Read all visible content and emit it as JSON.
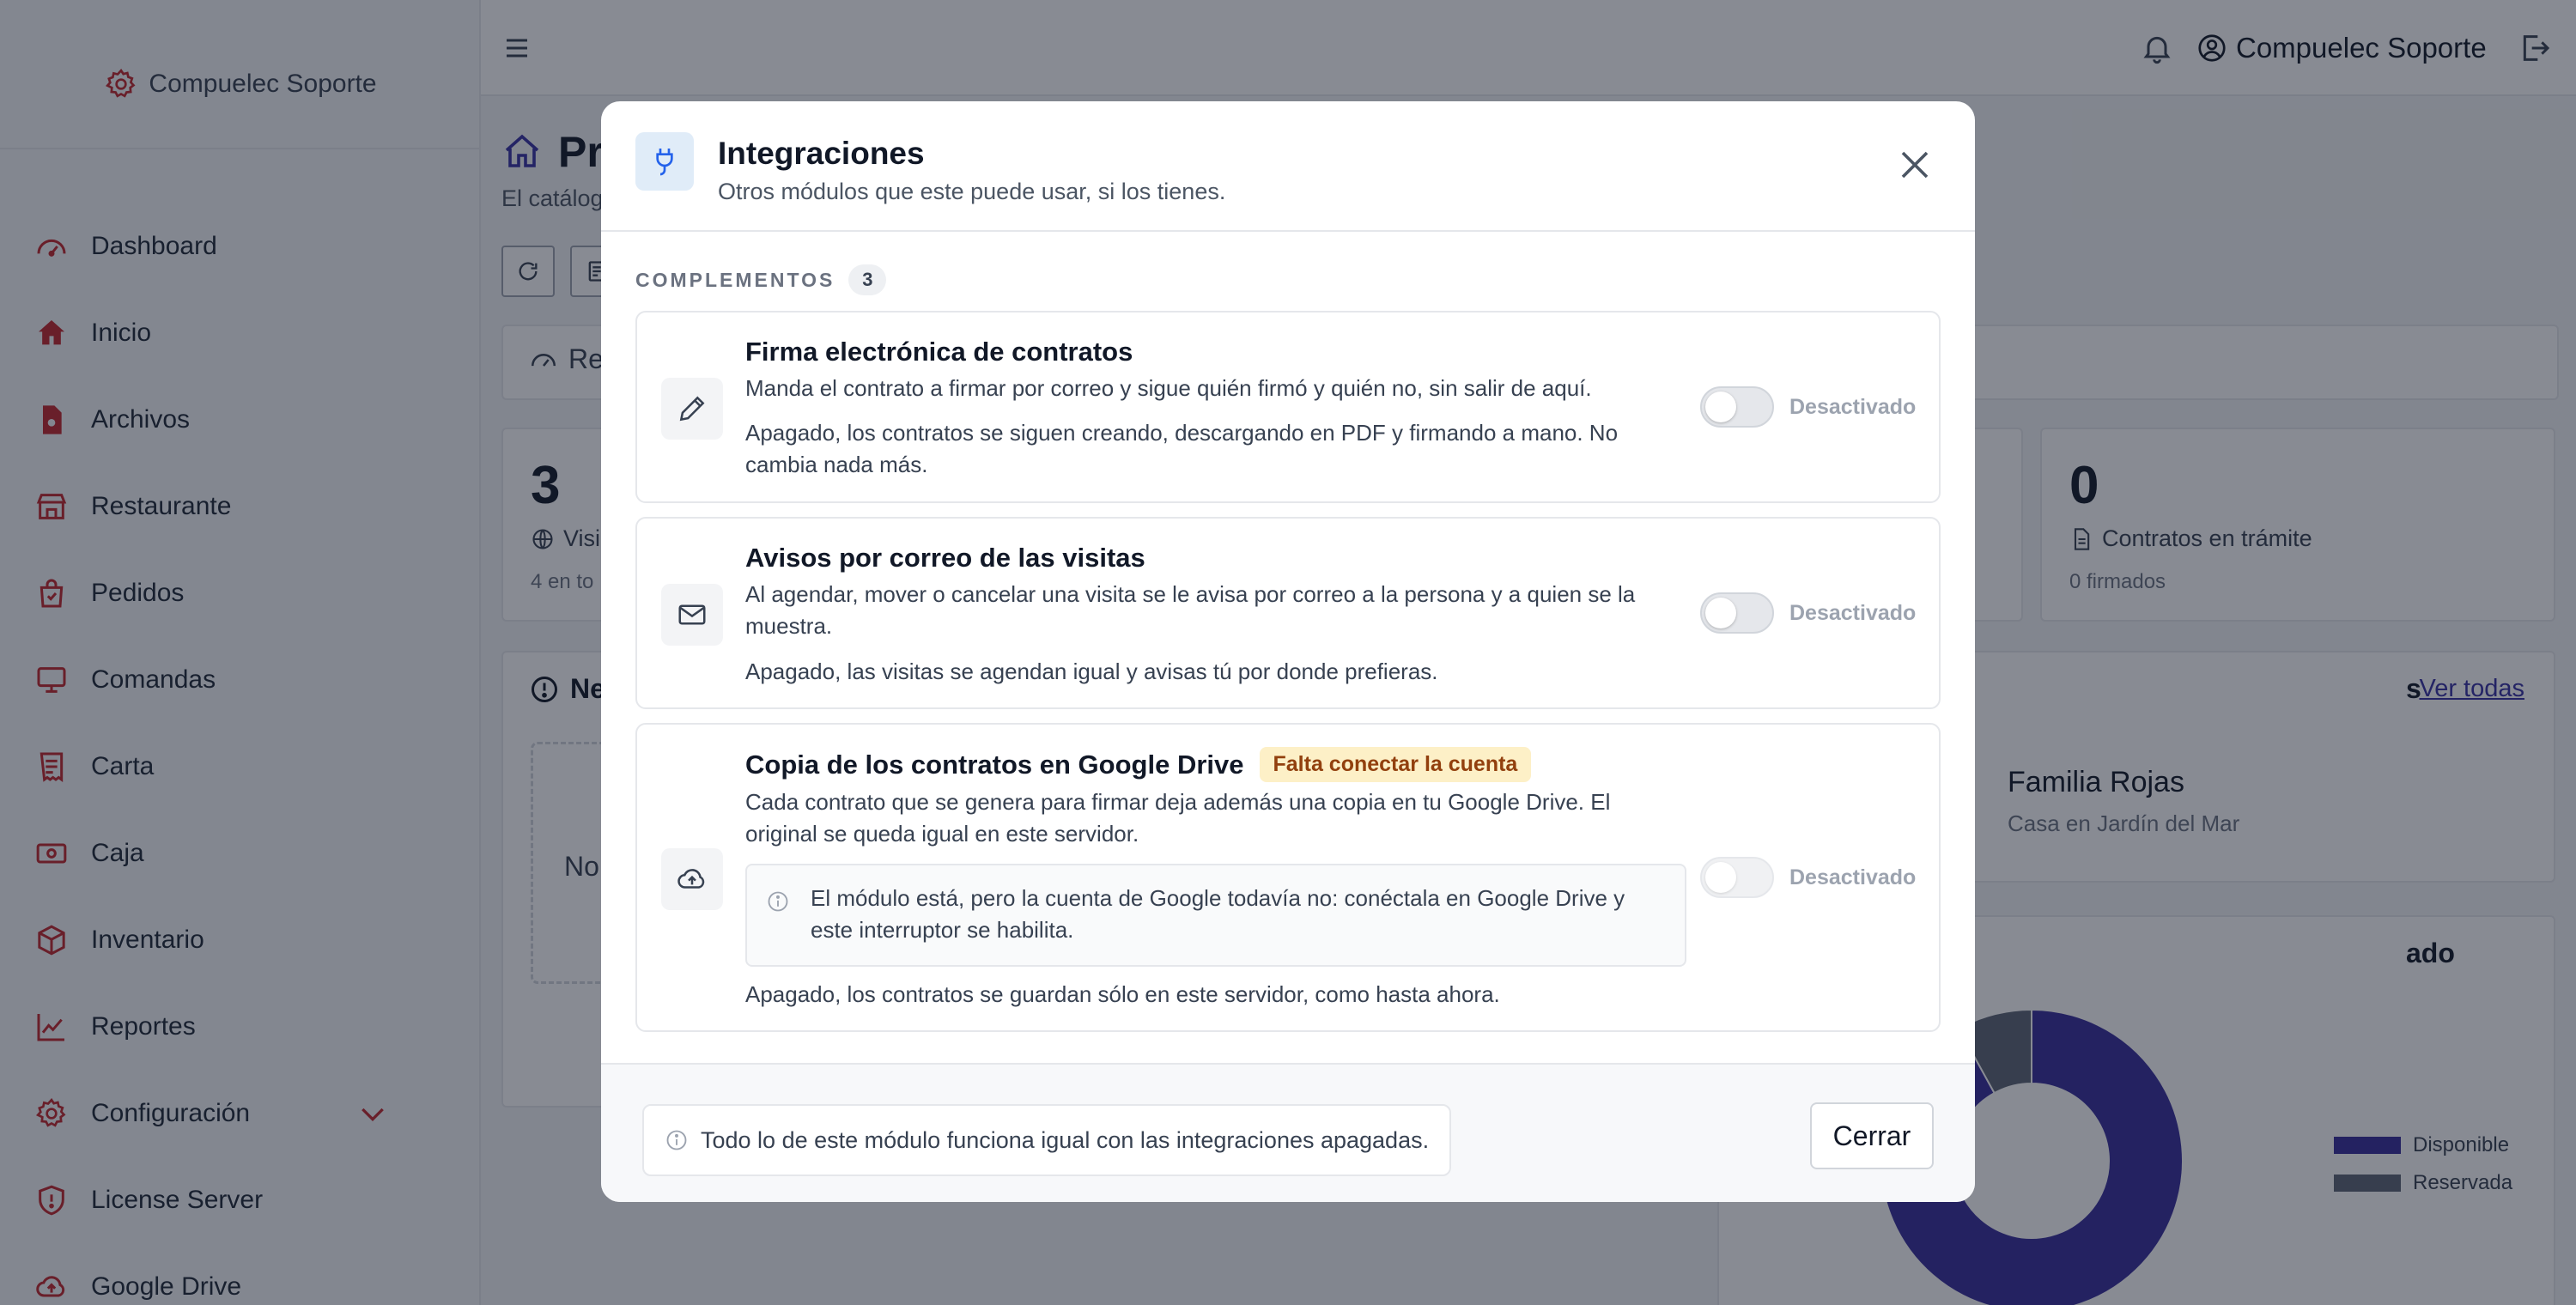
{
  "app": {
    "brand_name": "Compuelec Soporte",
    "user_name": "Compuelec Soporte"
  },
  "sidebar": {
    "items": [
      {
        "label": "Dashboard",
        "icon": "gauge-icon"
      },
      {
        "label": "Inicio",
        "icon": "home-icon"
      },
      {
        "label": "Archivos",
        "icon": "file-icon"
      },
      {
        "label": "Restaurante",
        "icon": "shop-icon"
      },
      {
        "label": "Pedidos",
        "icon": "bag-icon"
      },
      {
        "label": "Comandas",
        "icon": "monitor-icon"
      },
      {
        "label": "Carta",
        "icon": "receipt-icon"
      },
      {
        "label": "Caja",
        "icon": "cash-icon"
      },
      {
        "label": "Inventario",
        "icon": "box-icon"
      },
      {
        "label": "Reportes",
        "icon": "chart-icon"
      },
      {
        "label": "Configuración",
        "icon": "gear-icon"
      },
      {
        "label": "License Server",
        "icon": "shield-icon"
      },
      {
        "label": "Google Drive",
        "icon": "cloud-upload-icon"
      }
    ]
  },
  "background": {
    "page_title": "Pr",
    "page_subtitle": "El catálog",
    "first_tab": "Res",
    "stats": [
      {
        "value": "3",
        "label": "Visi",
        "foot": "4 en to"
      },
      {
        "value": "0",
        "label": "Contratos en trámite",
        "foot": "0 firmados"
      }
    ],
    "news_panel_title": "Ne",
    "news_empty_text": "No",
    "visits_panel_title": "s",
    "see_all_link": "Ver todas",
    "visit_family": "Familia Rojas",
    "visit_place": "Casa en Jardín del Mar",
    "status_panel_title": "ado",
    "chart_data": {
      "type": "pie",
      "categories": [
        "Disponible",
        "Reservada"
      ],
      "values": [
        92,
        8
      ],
      "colors": [
        "#372d9a",
        "#5c6474"
      ]
    }
  },
  "modal": {
    "title": "Integraciones",
    "subtitle": "Otros módulos que este puede usar, si los tienes.",
    "section_label": "COMPLEMENTOS",
    "section_count": "3",
    "cards": [
      {
        "title": "Firma electrónica de contratos",
        "description": "Manda el contrato a firmar por correo y sigue quién firmó y quién no, sin salir de aquí.",
        "note": "Apagado, los contratos se siguen creando, descargando en PDF y firmando a mano. No cambia nada más.",
        "toggle_state": "Desactivado",
        "icon": "pen-icon"
      },
      {
        "title": "Avisos por correo de las visitas",
        "description": "Al agendar, mover o cancelar una visita se le avisa por correo a la persona y a quien se la muestra.",
        "note": "Apagado, las visitas se agendan igual y avisas tú por donde prefieras.",
        "toggle_state": "Desactivado",
        "icon": "envelope-icon"
      },
      {
        "title": "Copia de los contratos en Google Drive",
        "badge": "Falta conectar la cuenta",
        "description": "Cada contrato que se genera para firmar deja además una copia en tu Google Drive. El original se queda igual en este servidor.",
        "info": "El módulo está, pero la cuenta de Google todavía no: conéctala en Google Drive y este interruptor se habilita.",
        "note": "Apagado, los contratos se guardan sólo en este servidor, como hasta ahora.",
        "toggle_state": "Desactivado",
        "icon": "cloud-upload-icon"
      }
    ],
    "footer_note": "Todo lo de este módulo funciona igual con las integraciones apagadas.",
    "close_label": "Cerrar"
  }
}
